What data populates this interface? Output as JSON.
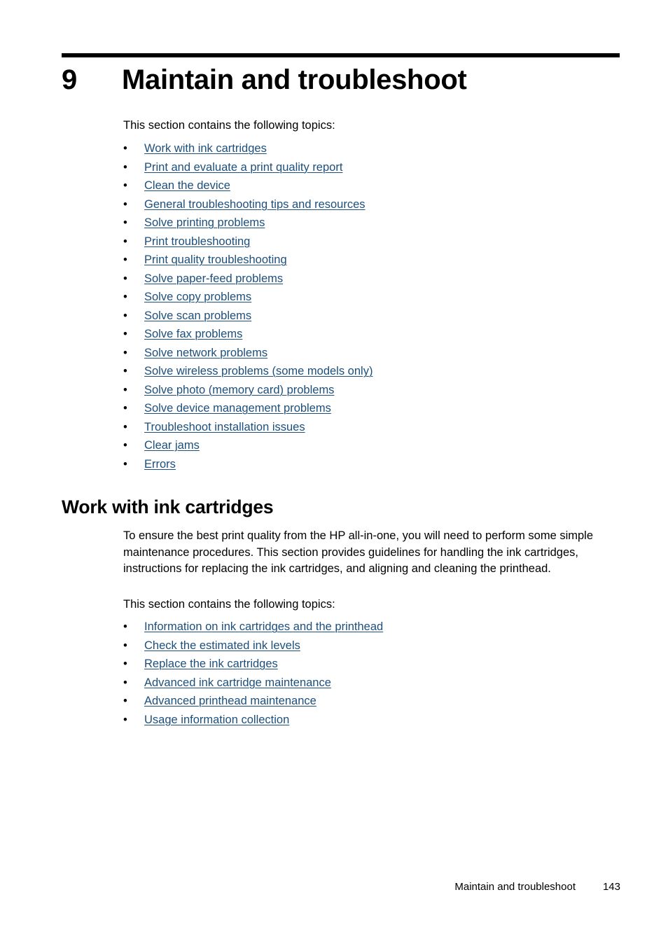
{
  "chapter": {
    "number": "9",
    "title": "Maintain and troubleshoot"
  },
  "intro": {
    "topics_lead_1": "This section contains the following topics:",
    "topics_lead_2": "This section contains the following topics:"
  },
  "chapter_topics": [
    {
      "bullet": "•",
      "label": "Work with ink cartridges"
    },
    {
      "bullet": "•",
      "label": "Print and evaluate a print quality report"
    },
    {
      "bullet": "•",
      "label": "Clean the device"
    },
    {
      "bullet": "•",
      "label": "General troubleshooting tips and resources"
    },
    {
      "bullet": "•",
      "label": "Solve printing problems"
    },
    {
      "bullet": "•",
      "label": "Print troubleshooting"
    },
    {
      "bullet": "•",
      "label": "Print quality troubleshooting"
    },
    {
      "bullet": "•",
      "label": "Solve paper-feed problems"
    },
    {
      "bullet": "•",
      "label": "Solve copy problems"
    },
    {
      "bullet": "•",
      "label": "Solve scan problems"
    },
    {
      "bullet": "•",
      "label": "Solve fax problems"
    },
    {
      "bullet": "•",
      "label": "Solve network problems"
    },
    {
      "bullet": "•",
      "label": "Solve wireless problems (some models only)"
    },
    {
      "bullet": "•",
      "label": "Solve photo (memory card) problems"
    },
    {
      "bullet": "•",
      "label": "Solve device management problems"
    },
    {
      "bullet": "•",
      "label": "Troubleshoot installation issues"
    },
    {
      "bullet": "•",
      "label": "Clear jams"
    },
    {
      "bullet": "•",
      "label": "Errors"
    }
  ],
  "section": {
    "heading": "Work with ink cartridges",
    "paragraph": "To ensure the best print quality from the HP all-in-one, you will need to perform some simple maintenance procedures. This section provides guidelines for handling the ink cartridges, instructions for replacing the ink cartridges, and aligning and cleaning the printhead."
  },
  "section_topics": [
    {
      "bullet": "•",
      "label": "Information on ink cartridges and the printhead"
    },
    {
      "bullet": "•",
      "label": "Check the estimated ink levels"
    },
    {
      "bullet": "•",
      "label": "Replace the ink cartridges"
    },
    {
      "bullet": "•",
      "label": "Advanced ink cartridge maintenance"
    },
    {
      "bullet": "•",
      "label": "Advanced printhead maintenance"
    },
    {
      "bullet": "•",
      "label": "Usage information collection"
    }
  ],
  "footer": {
    "chapter_name": "Maintain and troubleshoot",
    "page_number": "143"
  },
  "colors": {
    "link": "#1c4f7c",
    "text": "#000000",
    "rule": "#000000",
    "background": "#ffffff"
  }
}
